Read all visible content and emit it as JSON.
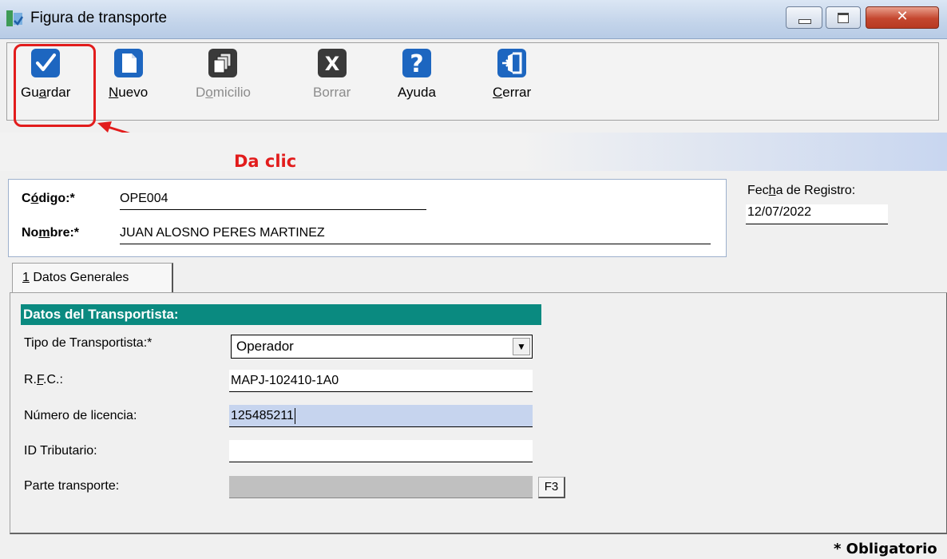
{
  "window": {
    "title": "Figura de transporte",
    "close_glyph": "✕"
  },
  "toolbar": {
    "buttons": [
      {
        "id": "guardar",
        "pre": "Gu",
        "u": "a",
        "post": "rdar",
        "icon": "checkbox-check-icon",
        "enabled": true
      },
      {
        "id": "nuevo",
        "pre": "",
        "u": "N",
        "post": "uevo",
        "icon": "new-document-icon",
        "enabled": true
      },
      {
        "id": "domicilio",
        "pre": "D",
        "u": "o",
        "post": "micilio",
        "icon": "documents-stack-icon",
        "enabled": false
      },
      {
        "id": "borrar",
        "pre": "Borrar",
        "u": "",
        "post": "",
        "icon": "delete-x-icon",
        "enabled": false
      },
      {
        "id": "ayuda",
        "pre": "Ayuda",
        "u": "",
        "post": "",
        "icon": "help-question-icon",
        "enabled": true
      },
      {
        "id": "cerrar",
        "pre": "",
        "u": "C",
        "post": "errar",
        "icon": "exit-door-icon",
        "enabled": true
      }
    ]
  },
  "annotation": {
    "callout": "Da clic",
    "color": "#e21c1c"
  },
  "header": {
    "codigo_pre": "C",
    "codigo_u": "ó",
    "codigo_post": "digo:*",
    "codigo_value": "OPE004",
    "nombre_pre": "No",
    "nombre_u": "m",
    "nombre_post": "bre:*",
    "nombre_value": "JUAN ALOSNO PERES MARTINEZ",
    "fecha_pre": "Fec",
    "fecha_u": "h",
    "fecha_post": "a de Registro:",
    "fecha_value": "12/07/2022"
  },
  "tabs": [
    {
      "u": "1",
      "label": " Datos Generales",
      "selected": true
    }
  ],
  "section": {
    "title": "Datos del Transportista:",
    "color": "#0a8a80"
  },
  "form": {
    "tipo_label": "Tipo de Transportista:*",
    "tipo_value": "Operador",
    "rfc_pre": "R.",
    "rfc_u": "F",
    "rfc_post": ".C.:",
    "rfc_value": "MAPJ-102410-1A0",
    "licencia_label": "Número de licencia:",
    "licencia_value": "125485211",
    "id_label": "ID Tributario:",
    "id_value": "",
    "parte_label": "Parte transporte:",
    "parte_value": "",
    "f3_label": "F3"
  },
  "footer": {
    "required_note": "* Obligatorio"
  }
}
